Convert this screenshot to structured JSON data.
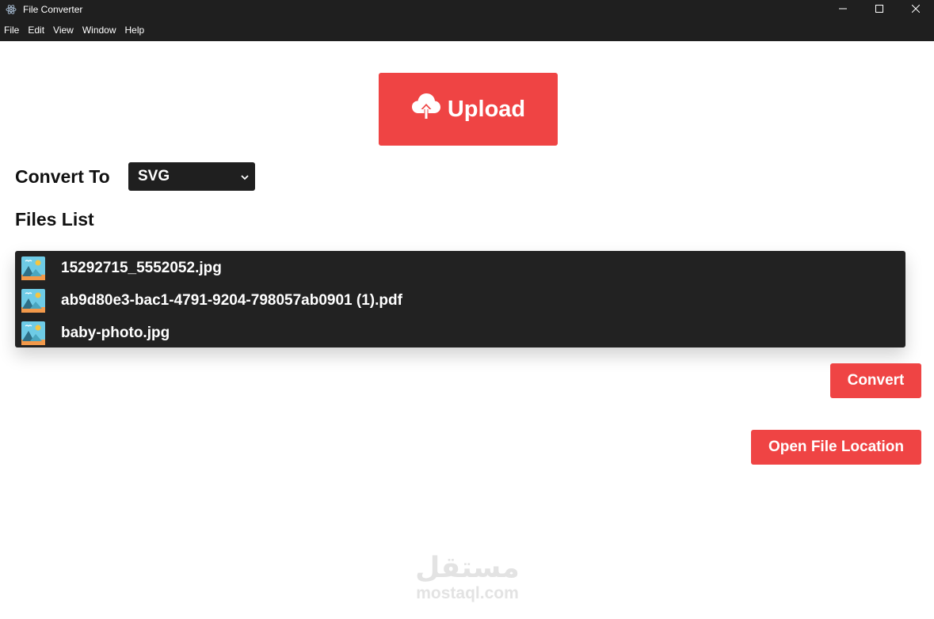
{
  "window": {
    "title": "File Converter",
    "icon": "electron-atom-icon",
    "controls": [
      "minimize-icon",
      "maximize-icon",
      "close-icon"
    ]
  },
  "menu": [
    "File",
    "Edit",
    "View",
    "Window",
    "Help"
  ],
  "upload": {
    "label": "Upload",
    "icon": "cloud-upload-icon"
  },
  "convert_to": {
    "label": "Convert To",
    "selected": "SVG",
    "icon": "chevron-down-icon"
  },
  "files": {
    "heading": "Files List",
    "items": [
      {
        "name": "15292715_5552052.jpg",
        "icon": "image-file-icon"
      },
      {
        "name": "ab9d80e3-bac1-4791-9204-798057ab0901 (1).pdf",
        "icon": "image-file-icon"
      },
      {
        "name": "baby-photo.jpg",
        "icon": "image-file-icon"
      }
    ]
  },
  "actions": {
    "convert": "Convert",
    "open_location": "Open File Location"
  },
  "watermark": {
    "arabic": "مستقل",
    "latin": "mostaql.com"
  },
  "colors": {
    "accent": "#ef4444",
    "chrome": "#1f1f1f",
    "list_bg": "#222222"
  }
}
